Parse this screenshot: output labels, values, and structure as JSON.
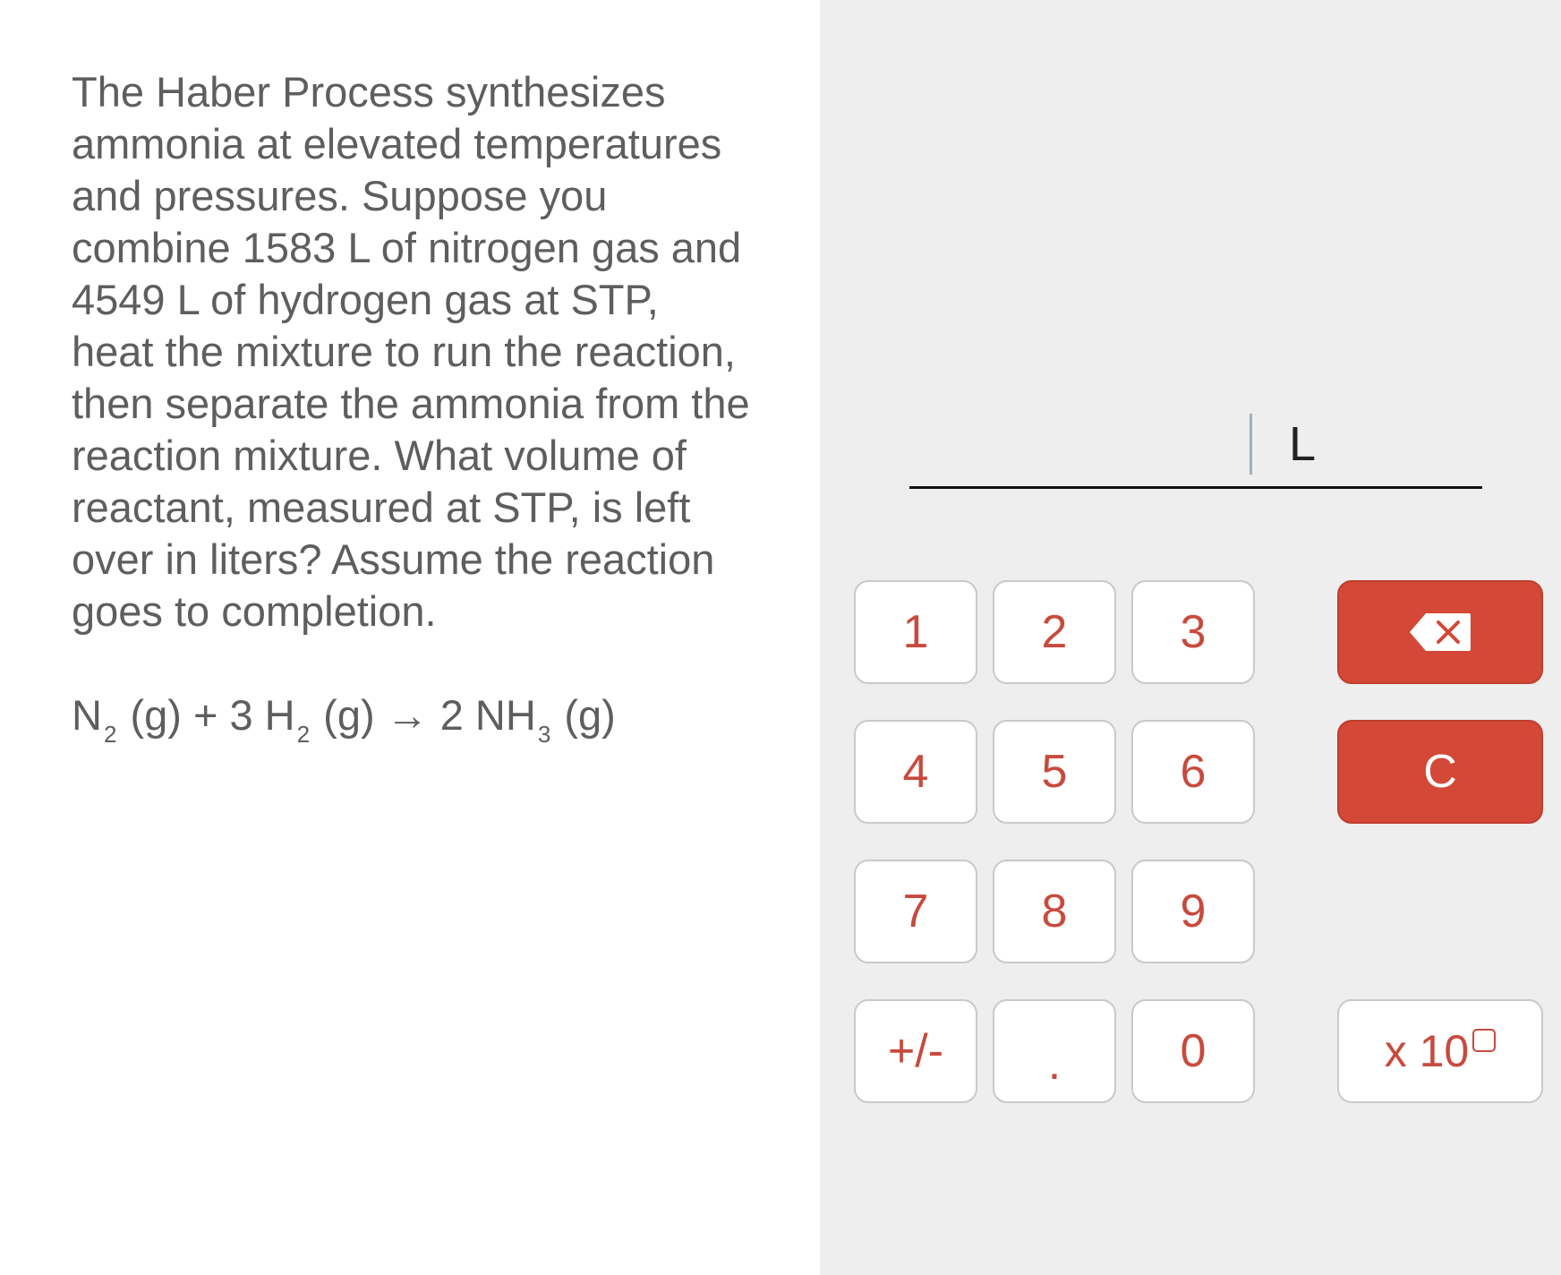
{
  "question": {
    "text": "The Haber Process synthesizes ammonia at elevated temperatures and pressures. Suppose you combine 1583 L of nitrogen gas and 4549 L of hydrogen gas at STP, heat the mixture to run the reaction, then separate the ammonia from the reaction mixture. What volume of reactant, measured at STP, is left over in liters? Assume the reaction goes to completion.",
    "equation": {
      "n_symbol": "N",
      "n_sub": "2",
      "part1": "(g) + 3 H",
      "h_sub": "2",
      "part2": "(g) → 2 NH",
      "nh_sub": "3",
      "part3": "(g)"
    }
  },
  "answer": {
    "value": "",
    "unit": "L"
  },
  "keypad": {
    "digits": [
      "1",
      "2",
      "3",
      "4",
      "5",
      "6",
      "7",
      "8",
      "9"
    ],
    "plus_minus": "+/-",
    "decimal": ".",
    "zero": "0",
    "clear": "C",
    "sci_notation": "x 10",
    "backspace_icon": "backspace-icon"
  },
  "colors": {
    "key_text": "#c84a3d",
    "accent_red": "#d34836",
    "right_panel_bg": "#eeeeee",
    "question_text": "#5e5e5e"
  }
}
